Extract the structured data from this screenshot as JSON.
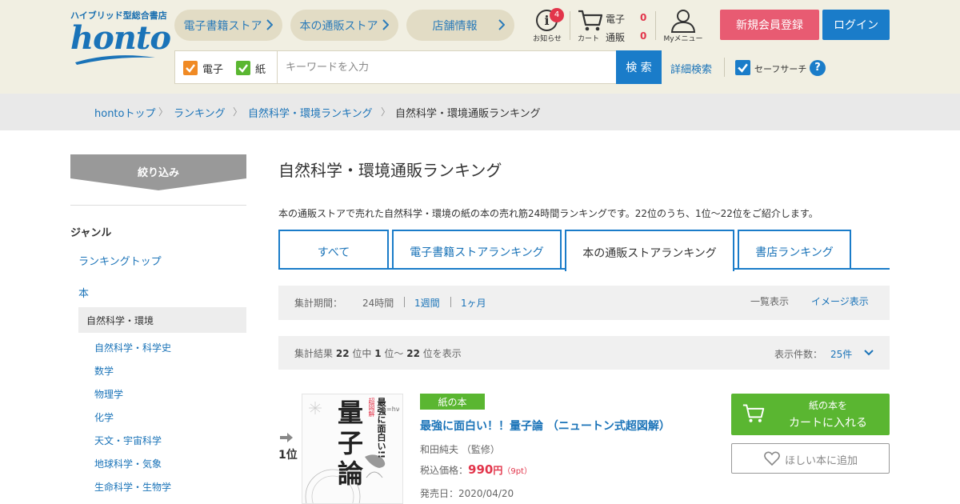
{
  "header": {
    "logo_tagline": "ハイブリッド型総合書店",
    "logo": "honto",
    "nav": [
      {
        "label": "電子書籍ストア"
      },
      {
        "label": "本の通販ストア"
      },
      {
        "label": "店舗情報"
      }
    ],
    "info": {
      "badge": "4",
      "label": "お知らせ"
    },
    "cart": {
      "label": "カート",
      "ebook_label": "電子",
      "ebook_count": "0",
      "paper_label": "通販",
      "paper_count": "0"
    },
    "mymenu_label": "Myメニュー",
    "register_label": "新規会員登録",
    "login_label": "ログイン"
  },
  "search": {
    "ebook_check_label": "電子",
    "paper_check_label": "紙",
    "placeholder": "キーワードを入力",
    "button_label": "検 索",
    "advanced_label": "詳細検索",
    "safe_search_label": "セーフサーチ",
    "help_glyph": "?"
  },
  "breadcrumb": [
    "hontoトップ",
    "ランキング",
    "自然科学・環境ランキング",
    "自然科学・環境通販ランキング"
  ],
  "breadcrumb_sep": "〉",
  "sidebar": {
    "filter_label": "絞り込み",
    "genre_heading": "ジャンル",
    "ranking_top": "ランキングトップ",
    "books": "本",
    "active": "自然科学・環境",
    "sub_items": [
      "自然科学・科学史",
      "数学",
      "物理学",
      "化学",
      "天文・宇宙科学",
      "地球科学・気象",
      "生命科学・生物学"
    ]
  },
  "main": {
    "title": "自然科学・環境通販ランキング",
    "description": "本の通販ストアで売れた自然科学・環境の紙の本の売れ筋24時間ランキングです。22位のうち、1位～22位をご紹介します。",
    "tabs": [
      "すべて",
      "電子書籍ストアランキング",
      "本の通販ストアランキング",
      "書店ランキング"
    ],
    "active_tab": 2,
    "period": {
      "label": "集計期間：",
      "options": [
        "24時間",
        "1週間",
        "1ヶ月"
      ],
      "selected": 0
    },
    "view": {
      "list": "一覧表示",
      "image": "イメージ表示"
    },
    "results": {
      "prefix": "集計結果",
      "total": "22",
      "mid": "位中",
      "from": "1",
      "tilde": "位～",
      "to": "22",
      "suffix": "位を表示"
    },
    "per_page": {
      "label": "表示件数：",
      "value": "25件"
    }
  },
  "item": {
    "rank": "1位",
    "badge": "紙の本",
    "title": "最強に面白い！！量子論 （ニュートン式超図解）",
    "author": "和田純夫 （監修）",
    "price_label": "税込価格：",
    "price": "990",
    "price_unit": "円",
    "points": "（9pt）",
    "release": "発売日：2020/04/20",
    "cart_line1": "紙の本を",
    "cart_line2": "カートに入れる",
    "wish_label": "ほしい本に追加",
    "cover": {
      "series_small": "超図解",
      "series": "最強に面白い!!",
      "title_chars": [
        "量",
        "子",
        "論"
      ],
      "formula": "E=hν"
    }
  },
  "colors": {
    "header_bg": "#f1efe2",
    "brand_blue": "#1a7cc9",
    "register_pink": "#e85b72",
    "green": "#5ab631",
    "check_orange": "#f08a24",
    "check_green": "#5ab631",
    "badge_red": "#e2354b"
  }
}
